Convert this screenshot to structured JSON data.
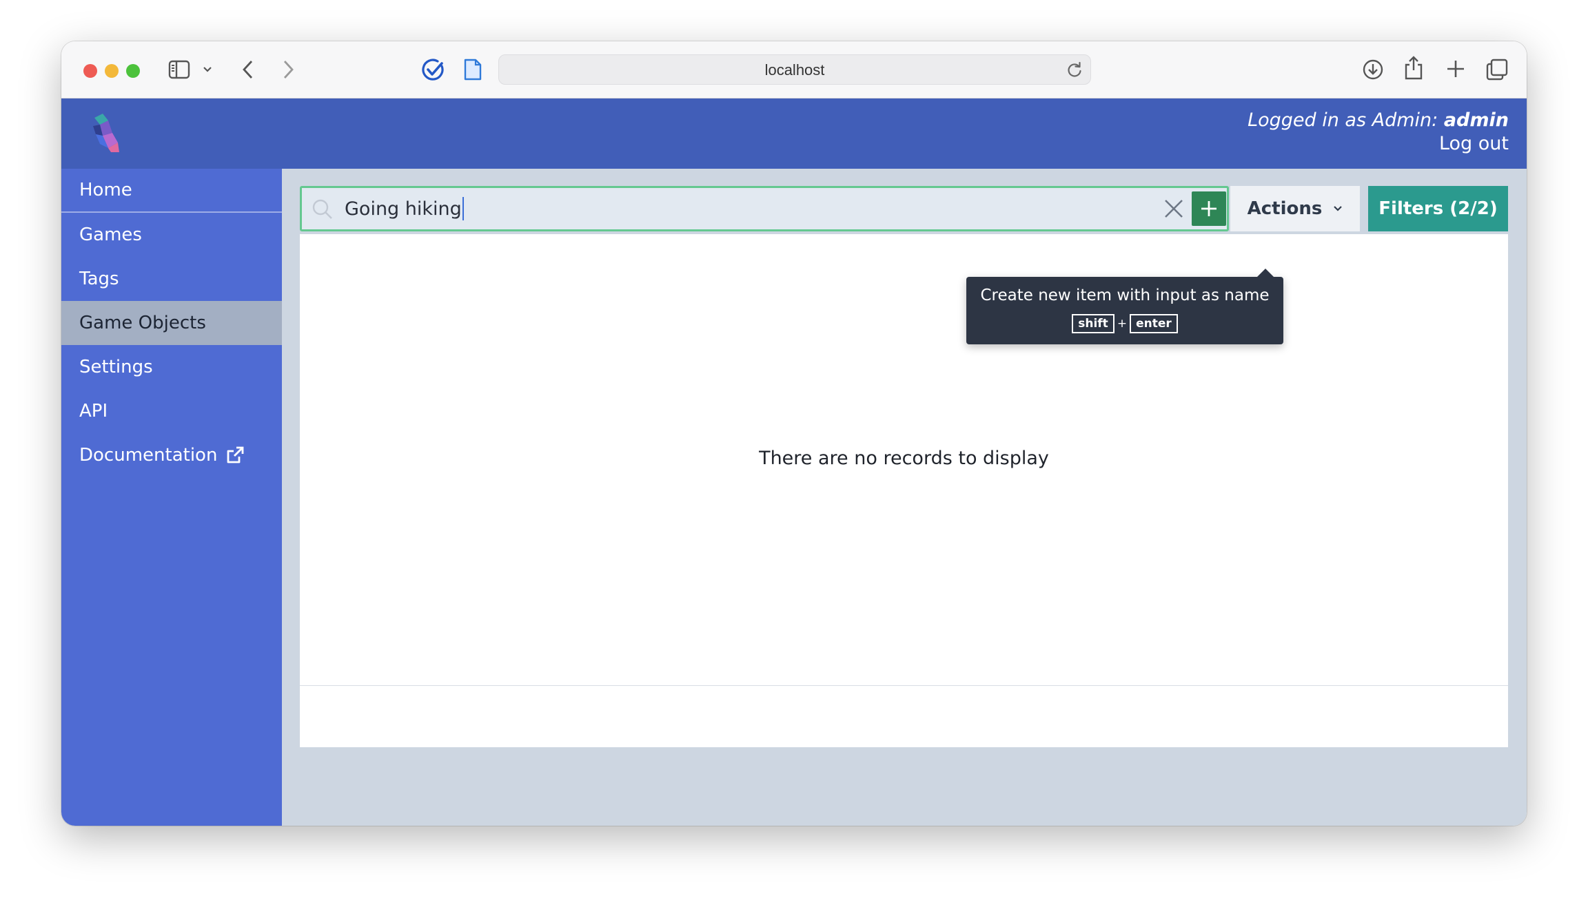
{
  "browser": {
    "url": "localhost"
  },
  "header": {
    "login_prefix": "Logged in as Admin: ",
    "login_user": "admin",
    "logout_label": "Log out"
  },
  "sidebar": {
    "items": [
      {
        "label": "Home"
      },
      {
        "label": "Games"
      },
      {
        "label": "Tags"
      },
      {
        "label": "Game Objects"
      },
      {
        "label": "Settings"
      },
      {
        "label": "API"
      },
      {
        "label": "Documentation"
      }
    ],
    "active": "Game Objects"
  },
  "search": {
    "value": "Going hiking"
  },
  "toolbar": {
    "actions_label": "Actions",
    "filters_label": "Filters (2/2)"
  },
  "tooltip": {
    "text": "Create new item with input as name",
    "key1": "shift",
    "plus": "+",
    "key2": "enter"
  },
  "content": {
    "empty_message": "There are no records to display"
  },
  "colors": {
    "header_bg": "#415eb8",
    "sidebar_bg": "#4f6bd3",
    "active_nav_bg": "#a3afc3",
    "add_button": "#2e8656",
    "filters_button": "#2b9a8e",
    "search_border": "#64c890"
  },
  "icons": {
    "sidebar_toggle": "sidebar-icon",
    "back": "chevron-left-icon",
    "forward": "chevron-right-icon",
    "extension_check": "checkmark-circle-icon",
    "extension_page": "page-icon",
    "reload": "reload-icon",
    "download": "download-icon",
    "share": "share-icon",
    "new_tab": "plus-icon",
    "tabs_overview": "tabs-icon",
    "search": "search-icon",
    "clear": "close-icon",
    "add": "plus-icon",
    "external_link": "external-link-icon"
  }
}
